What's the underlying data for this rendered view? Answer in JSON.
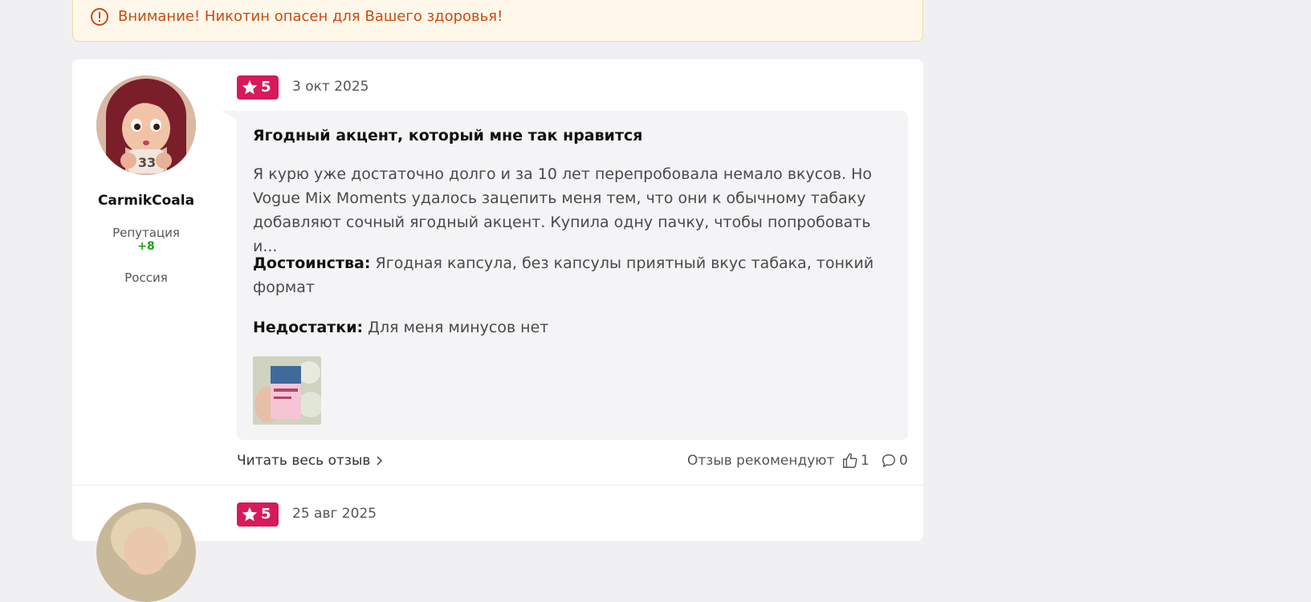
{
  "warning": {
    "text": "Внимание! Никотин опасен для Вашего здоровья!",
    "icon": "exclamation-circle-icon",
    "color": "#c94a10"
  },
  "reviews": [
    {
      "author": {
        "name": "CarmikCoala",
        "reputation_label": "Репутация",
        "reputation_value": "+8",
        "country": "Россия",
        "avatar": "avatar-image"
      },
      "rating": "5",
      "date": "3 окт 2025",
      "title": "Ягодный акцент, который мне так нравится",
      "text": "Я курю уже достаточно долго и за 10 лет перепробовала немало вкусов. Но Vogue Mix Moments удалось зацепить меня тем, что они к обычному табаку добавляют сочный ягодный акцент. Купила одну пачку, чтобы попробовать и...",
      "pros_label": "Достоинства:",
      "pros": "Ягодная капсула, без капсулы приятный вкус табака, тонкий формат",
      "cons_label": "Недостатки:",
      "cons": "Для меня минусов нет",
      "photo": "cigarette-pack-photo",
      "read_more": "Читать весь отзыв",
      "recommend_label": "Отзыв рекомендуют",
      "likes": "1",
      "comments": "0"
    },
    {
      "rating": "5",
      "date": "25 авг 2025"
    }
  ],
  "colors": {
    "accent": "#d61a5a",
    "reputation": "#1aa31a",
    "background": "#f0f0f2"
  }
}
